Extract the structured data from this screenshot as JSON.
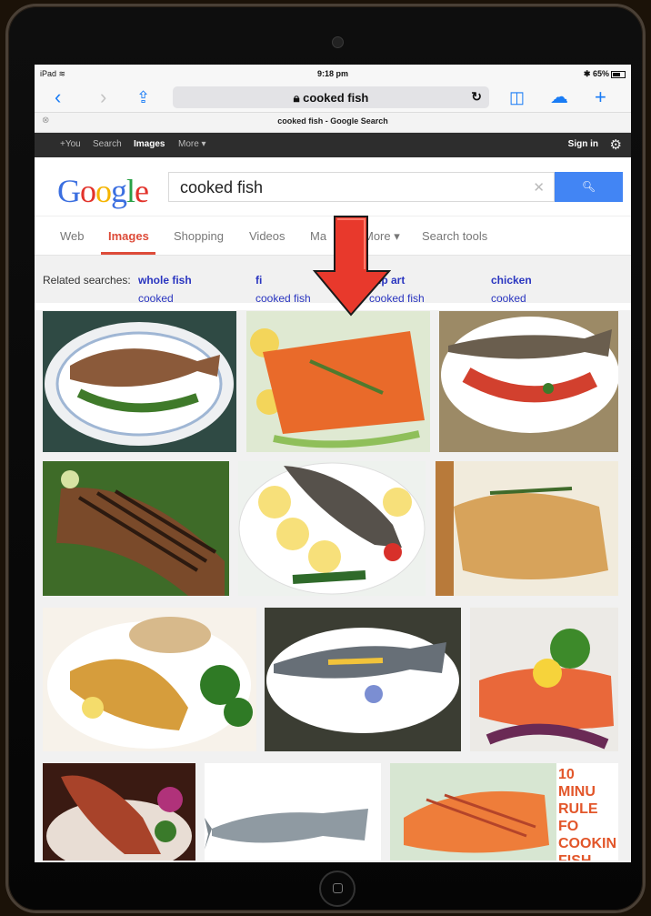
{
  "status_bar": {
    "device": "iPad",
    "time": "9:18 pm",
    "battery": "65%"
  },
  "safari": {
    "url_text": "cooked fish",
    "tab_title": "cooked fish - Google Search"
  },
  "google_bar": {
    "items": [
      "+You",
      "Search",
      "Images",
      "More ▾"
    ],
    "sign_in": "Sign in"
  },
  "search": {
    "logo": "Google",
    "query": "cooked fish"
  },
  "nav_tabs": [
    "Web",
    "Images",
    "Shopping",
    "Videos",
    "Ma",
    "More ▾",
    "Search tools"
  ],
  "related": {
    "label": "Related searches:",
    "links": [
      {
        "pre": "cooked ",
        "bold": "whole fish"
      },
      {
        "pre": "cooked fish ",
        "bold": "fi"
      },
      {
        "pre": "cooked fish ",
        "bold": "clip art"
      },
      {
        "pre": "cooked ",
        "bold": "chicken"
      }
    ]
  },
  "image_overlay_text": "10 MINU RULE FO COOKIN FISH.",
  "colors": {
    "accent_blue": "#1a7cf5",
    "google_red": "#dd4b39",
    "link_blue": "#2a35c0",
    "arrow_red": "#e8392c"
  }
}
